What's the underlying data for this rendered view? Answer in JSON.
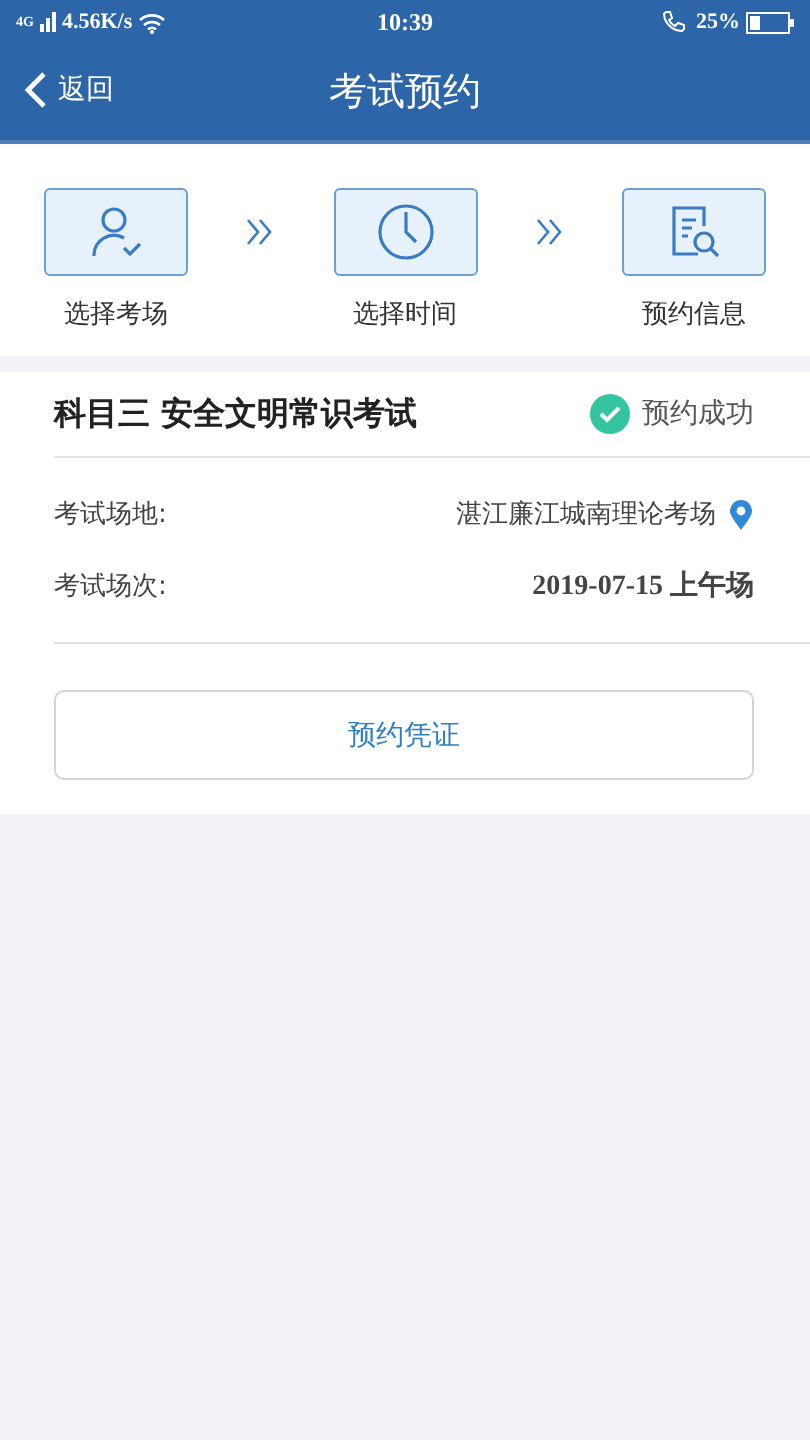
{
  "status_bar": {
    "network": "4G",
    "speed": "4.56K/s",
    "time": "10:39",
    "battery": "25%"
  },
  "nav": {
    "back": "返回",
    "title": "考试预约"
  },
  "steps": [
    {
      "label": "选择考场",
      "kind": "user"
    },
    {
      "label": "选择时间",
      "kind": "clock"
    },
    {
      "label": "预约信息",
      "kind": "doc"
    }
  ],
  "exam": {
    "title": "科目三 安全文明常识考试",
    "status": "预约成功"
  },
  "details": [
    {
      "label": "考试场地:",
      "value": "湛江廉江城南理论考场",
      "kind": "location"
    },
    {
      "label": "考试场次:",
      "value": "2019-07-15 上午场",
      "kind": "text"
    }
  ],
  "button": "预约凭证"
}
